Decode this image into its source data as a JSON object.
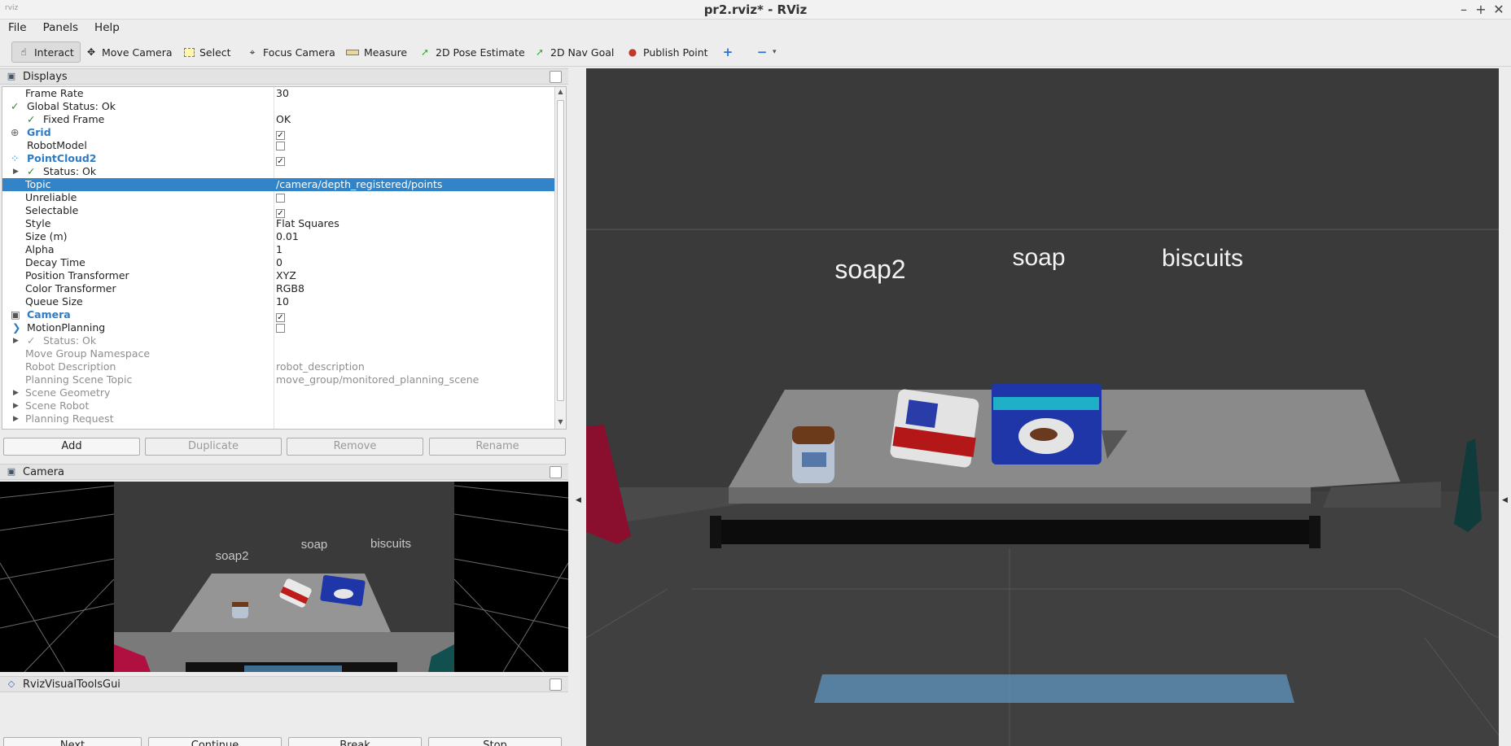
{
  "window": {
    "title": "pr2.rviz* - RViz",
    "icon_text": "rviz",
    "minimize": "–",
    "maximize": "+",
    "close": "✕"
  },
  "menu": [
    "File",
    "Panels",
    "Help"
  ],
  "toolbar": [
    {
      "label": "Interact",
      "icon": "pointer-icon",
      "active": true
    },
    {
      "label": "Move Camera",
      "icon": "move-camera-icon"
    },
    {
      "label": "Select",
      "icon": "select-icon"
    },
    {
      "label": "Focus Camera",
      "icon": "focus-camera-icon"
    },
    {
      "label": "Measure",
      "icon": "ruler-icon"
    },
    {
      "label": "2D Pose Estimate",
      "icon": "pose-arrow-icon"
    },
    {
      "label": "2D Nav Goal",
      "icon": "nav-goal-icon"
    },
    {
      "label": "Publish Point",
      "icon": "map-pin-icon"
    }
  ],
  "displays_panel": {
    "title": "Displays",
    "rows": [
      {
        "label": "Frame Rate",
        "value": "30"
      },
      {
        "label": "Global Status: Ok",
        "value": ""
      },
      {
        "label": "Fixed Frame",
        "value": "OK"
      },
      {
        "label": "Grid",
        "value": "",
        "checked": true
      },
      {
        "label": "RobotModel",
        "value": "",
        "checked": false
      },
      {
        "label": "PointCloud2",
        "value": "",
        "checked": true
      },
      {
        "label": "Status: Ok",
        "value": ""
      },
      {
        "label": "Topic",
        "value": "/camera/depth_registered/points"
      },
      {
        "label": "Unreliable",
        "value": "",
        "checked": false
      },
      {
        "label": "Selectable",
        "value": "",
        "checked": true
      },
      {
        "label": "Style",
        "value": "Flat Squares"
      },
      {
        "label": "Size (m)",
        "value": "0.01"
      },
      {
        "label": "Alpha",
        "value": "1"
      },
      {
        "label": "Decay Time",
        "value": "0"
      },
      {
        "label": "Position Transformer",
        "value": "XYZ"
      },
      {
        "label": "Color Transformer",
        "value": "RGB8"
      },
      {
        "label": "Queue Size",
        "value": "10"
      },
      {
        "label": "Camera",
        "value": "",
        "checked": true
      },
      {
        "label": "MotionPlanning",
        "value": "",
        "checked": false
      },
      {
        "label": "Status: Ok",
        "value": ""
      },
      {
        "label": "Move Group Namespace",
        "value": ""
      },
      {
        "label": "Robot Description",
        "value": "robot_description"
      },
      {
        "label": "Planning Scene Topic",
        "value": "move_group/monitored_planning_scene"
      },
      {
        "label": "Scene Geometry",
        "value": ""
      },
      {
        "label": "Scene Robot",
        "value": ""
      },
      {
        "label": "Planning Request",
        "value": ""
      }
    ],
    "buttons": [
      "Add",
      "Duplicate",
      "Remove",
      "Rename"
    ]
  },
  "camera_panel": {
    "title": "Camera",
    "labels": [
      "soap2",
      "soap",
      "biscuits"
    ]
  },
  "rviz_visual_tools_panel": {
    "title": "RvizVisualToolsGui",
    "buttons": [
      "Next",
      "Continue",
      "Break",
      "Stop"
    ]
  },
  "scene_3d": {
    "labels": [
      "soap2",
      "soap",
      "biscuits"
    ]
  },
  "colors": {
    "selection": "#3184c7",
    "display_name": "#2f7bc3",
    "status_ok": "#2a8a2a",
    "viewport_bg": "#3a3a3a"
  }
}
